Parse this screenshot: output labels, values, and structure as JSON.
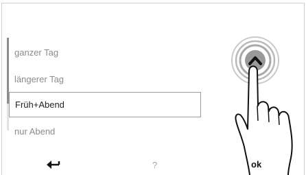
{
  "list": {
    "items": [
      {
        "label": "ganzer Tag",
        "selected": false
      },
      {
        "label": "längerer Tag",
        "selected": false
      },
      {
        "label": "Früh+Abend",
        "selected": true
      },
      {
        "label": "nur Abend",
        "selected": false
      }
    ]
  },
  "bottom_bar": {
    "back_icon": "back-arrow-icon",
    "help_label": "?",
    "ok_label": "ok"
  },
  "scroll_up_icon": "chevron-up-icon",
  "hand_icon": "pointing-hand-icon",
  "colors": {
    "frame": "#cfcfcf",
    "text_muted": "#8b8b8b",
    "text_selected": "#222222",
    "selection_border": "#9c9c9c",
    "scroll_thumb": "#8d8d8d",
    "press_rings": "#b5b5b5"
  }
}
